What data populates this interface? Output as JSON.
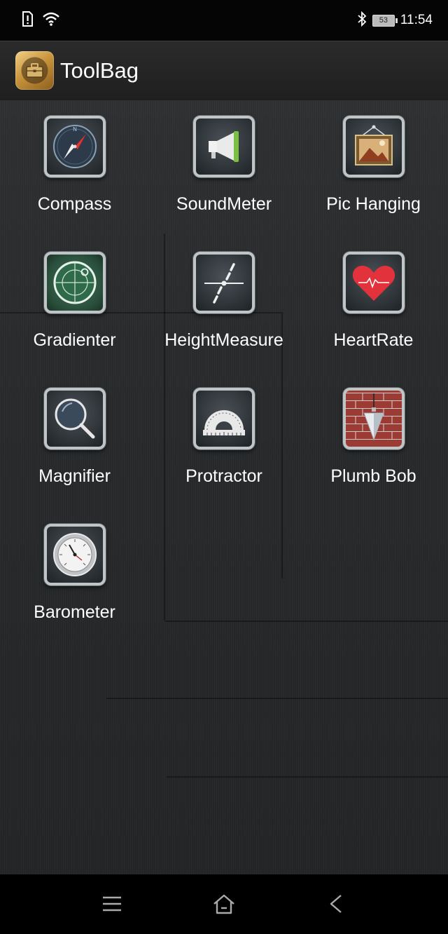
{
  "status_bar": {
    "time": "11:54",
    "battery_level": "53",
    "icons": [
      "sim-alert-icon",
      "wifi-icon",
      "bluetooth-icon",
      "battery-icon"
    ]
  },
  "app_bar": {
    "title": "ToolBag",
    "logo_icon": "toolbag-briefcase-icon"
  },
  "tools": [
    {
      "label": "Compass",
      "icon": "compass-icon"
    },
    {
      "label": "SoundMeter",
      "icon": "megaphone-icon"
    },
    {
      "label": "Pic Hanging",
      "icon": "picture-frame-icon"
    },
    {
      "label": "Gradienter",
      "icon": "level-icon"
    },
    {
      "label": "HeightMeasure",
      "icon": "height-measure-icon"
    },
    {
      "label": "HeartRate",
      "icon": "heart-icon"
    },
    {
      "label": "Magnifier",
      "icon": "magnifier-icon"
    },
    {
      "label": "Protractor",
      "icon": "protractor-icon"
    },
    {
      "label": "Plumb Bob",
      "icon": "plumb-bob-icon"
    },
    {
      "label": "Barometer",
      "icon": "barometer-icon"
    }
  ],
  "nav_bar": {
    "icons": [
      "menu-icon",
      "home-icon",
      "back-icon"
    ]
  },
  "colors": {
    "accent_gold": "#c9953d",
    "heart_red": "#e2323b",
    "level_green": "#2f6b4b",
    "megaphone_green": "#7ac143"
  }
}
